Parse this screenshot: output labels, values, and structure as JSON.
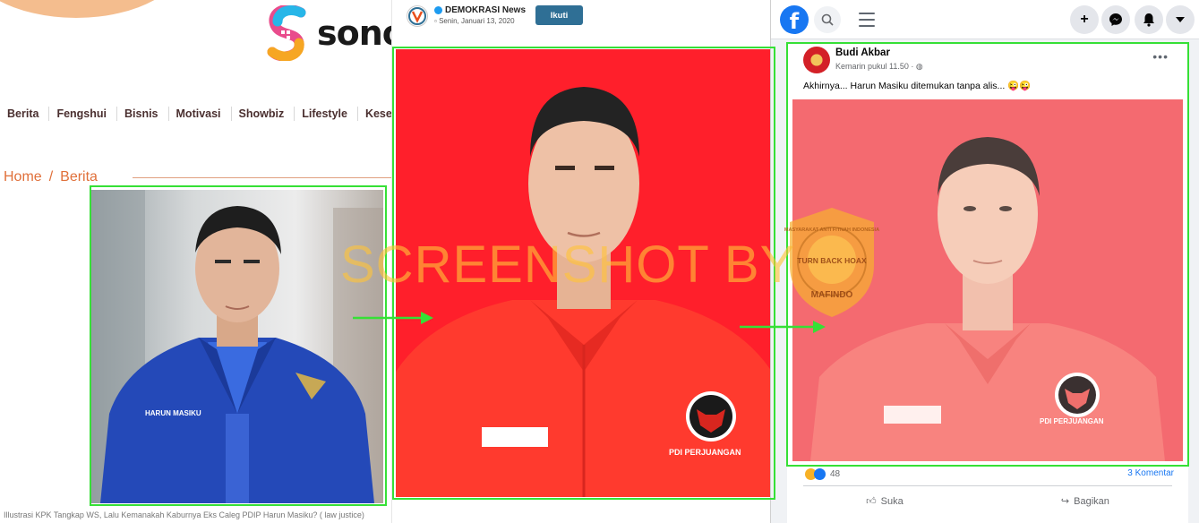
{
  "news_site": {
    "logo_text": "sono",
    "nav": [
      "Berita",
      "Fengshui",
      "Bisnis",
      "Motivasi",
      "Showbiz",
      "Lifestyle",
      "Kese"
    ],
    "breadcrumb": {
      "home": "Home",
      "separator": "/",
      "current": "Berita"
    },
    "jacket_name_tag": "HARUN MASIKU",
    "caption": "Illustrasi KPK Tangkap WS, Lalu Kemanakah Kaburnya Eks Caleg PDIP Harun Masiku?",
    "caption_credit": "( law justice)"
  },
  "social_post": {
    "account_name": "DEMOKRASI News",
    "date": "Senin, Januari 13, 2020",
    "follow_label": "Ikuti",
    "badge_text": "PDI PERJUANGAN"
  },
  "facebook": {
    "logo_letter": "f",
    "post": {
      "author": "Budi Akbar",
      "time": "Kemarin pukul 11.50 ·",
      "text": "Akhirnya... Harun Masiku ditemukan tanpa alis... 😜😜",
      "badge_text": "PDI PERJUANGAN",
      "reaction_count": "48",
      "comments": "3 Komentar",
      "like_label": "Suka",
      "share_label": "Bagikan"
    }
  },
  "watermark": {
    "text": "SCREENSHOT BY",
    "seal_center": "TURN BACK HOAX",
    "seal_ring": "MASYARAKAT ANTI FITNAH INDONESIA",
    "seal_bottom": "MAFINDO"
  },
  "colors": {
    "highlight_green": "#36e036",
    "fb_blue": "#1877f2",
    "red_backdrop": "#ff1f2b",
    "watermark_orange": "#ffc438"
  }
}
